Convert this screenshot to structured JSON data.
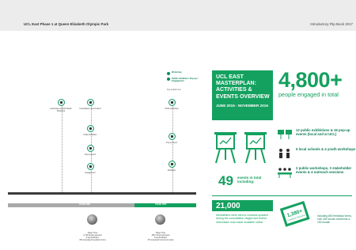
{
  "header": {
    "title": "UCL East Phase 1 at Queen Elizabeth Olympic Park",
    "right": "Introductory Flip Book 2017"
  },
  "timeline": {
    "legend": [
      {
        "label": "Workshop"
      },
      {
        "label": "Public exhibition / Pop-up / Engagement"
      }
    ],
    "legend_note": "Key location text",
    "nodes": [
      {
        "label": "Landscape & Public Realm Workshop"
      },
      {
        "label": "Consultation Launch Event"
      },
      {
        "label": "Public Exhibition"
      },
      {
        "label": "Pop-up Event"
      },
      {
        "label": "Engagement"
      },
      {
        "label": "Public Workshop"
      },
      {
        "label": "Pop-up Event"
      },
      {
        "label": "Exhibition"
      }
    ],
    "band_labels": [
      "STAGE ONE",
      "STAGE TWO"
    ],
    "stages": [
      {
        "title": "Stage Three",
        "line1": "4,736 People Attended",
        "line2": "6 day Exhibition",
        "line3": "352 Completed Feedback Forms"
      },
      {
        "title": "Stage Three",
        "line1": "488+ People Attended",
        "line2": "4 day Exhibition",
        "line3": "35 Completed Comments Cards"
      }
    ]
  },
  "overview": {
    "title": "UCL EAST MASTERPLAN: ACTIVITIES & EVENTS OVERVIEW",
    "dates": "JUNE 2015 - NOVEMBER 2016"
  },
  "engagement": {
    "number": "4,800+",
    "caption": "people engaged in total"
  },
  "events": {
    "number": "49",
    "caption": "events in total including:"
  },
  "stats": [
    {
      "text": "12 public exhibitions & 19 pop-up events (local and at UCL)"
    },
    {
      "text": "5 local schools & 4 youth workshops"
    },
    {
      "text": "2 public workshops, 3 stakeholder events & 4 outreach sessions"
    }
  ],
  "leaflets": {
    "number": "21,000",
    "caption": "Newsletters were sent to contacts updated during the consultation stages and further information was made available online."
  },
  "feedback": {
    "card_number": "1,380+",
    "card_label": "Feedback Received",
    "caption": "including 650 feedback forms, over 450 social comments & 190 emails"
  },
  "colors": {
    "accent": "#14a15f",
    "dark": "#0b7a55",
    "axis": "#3b3b3b"
  }
}
